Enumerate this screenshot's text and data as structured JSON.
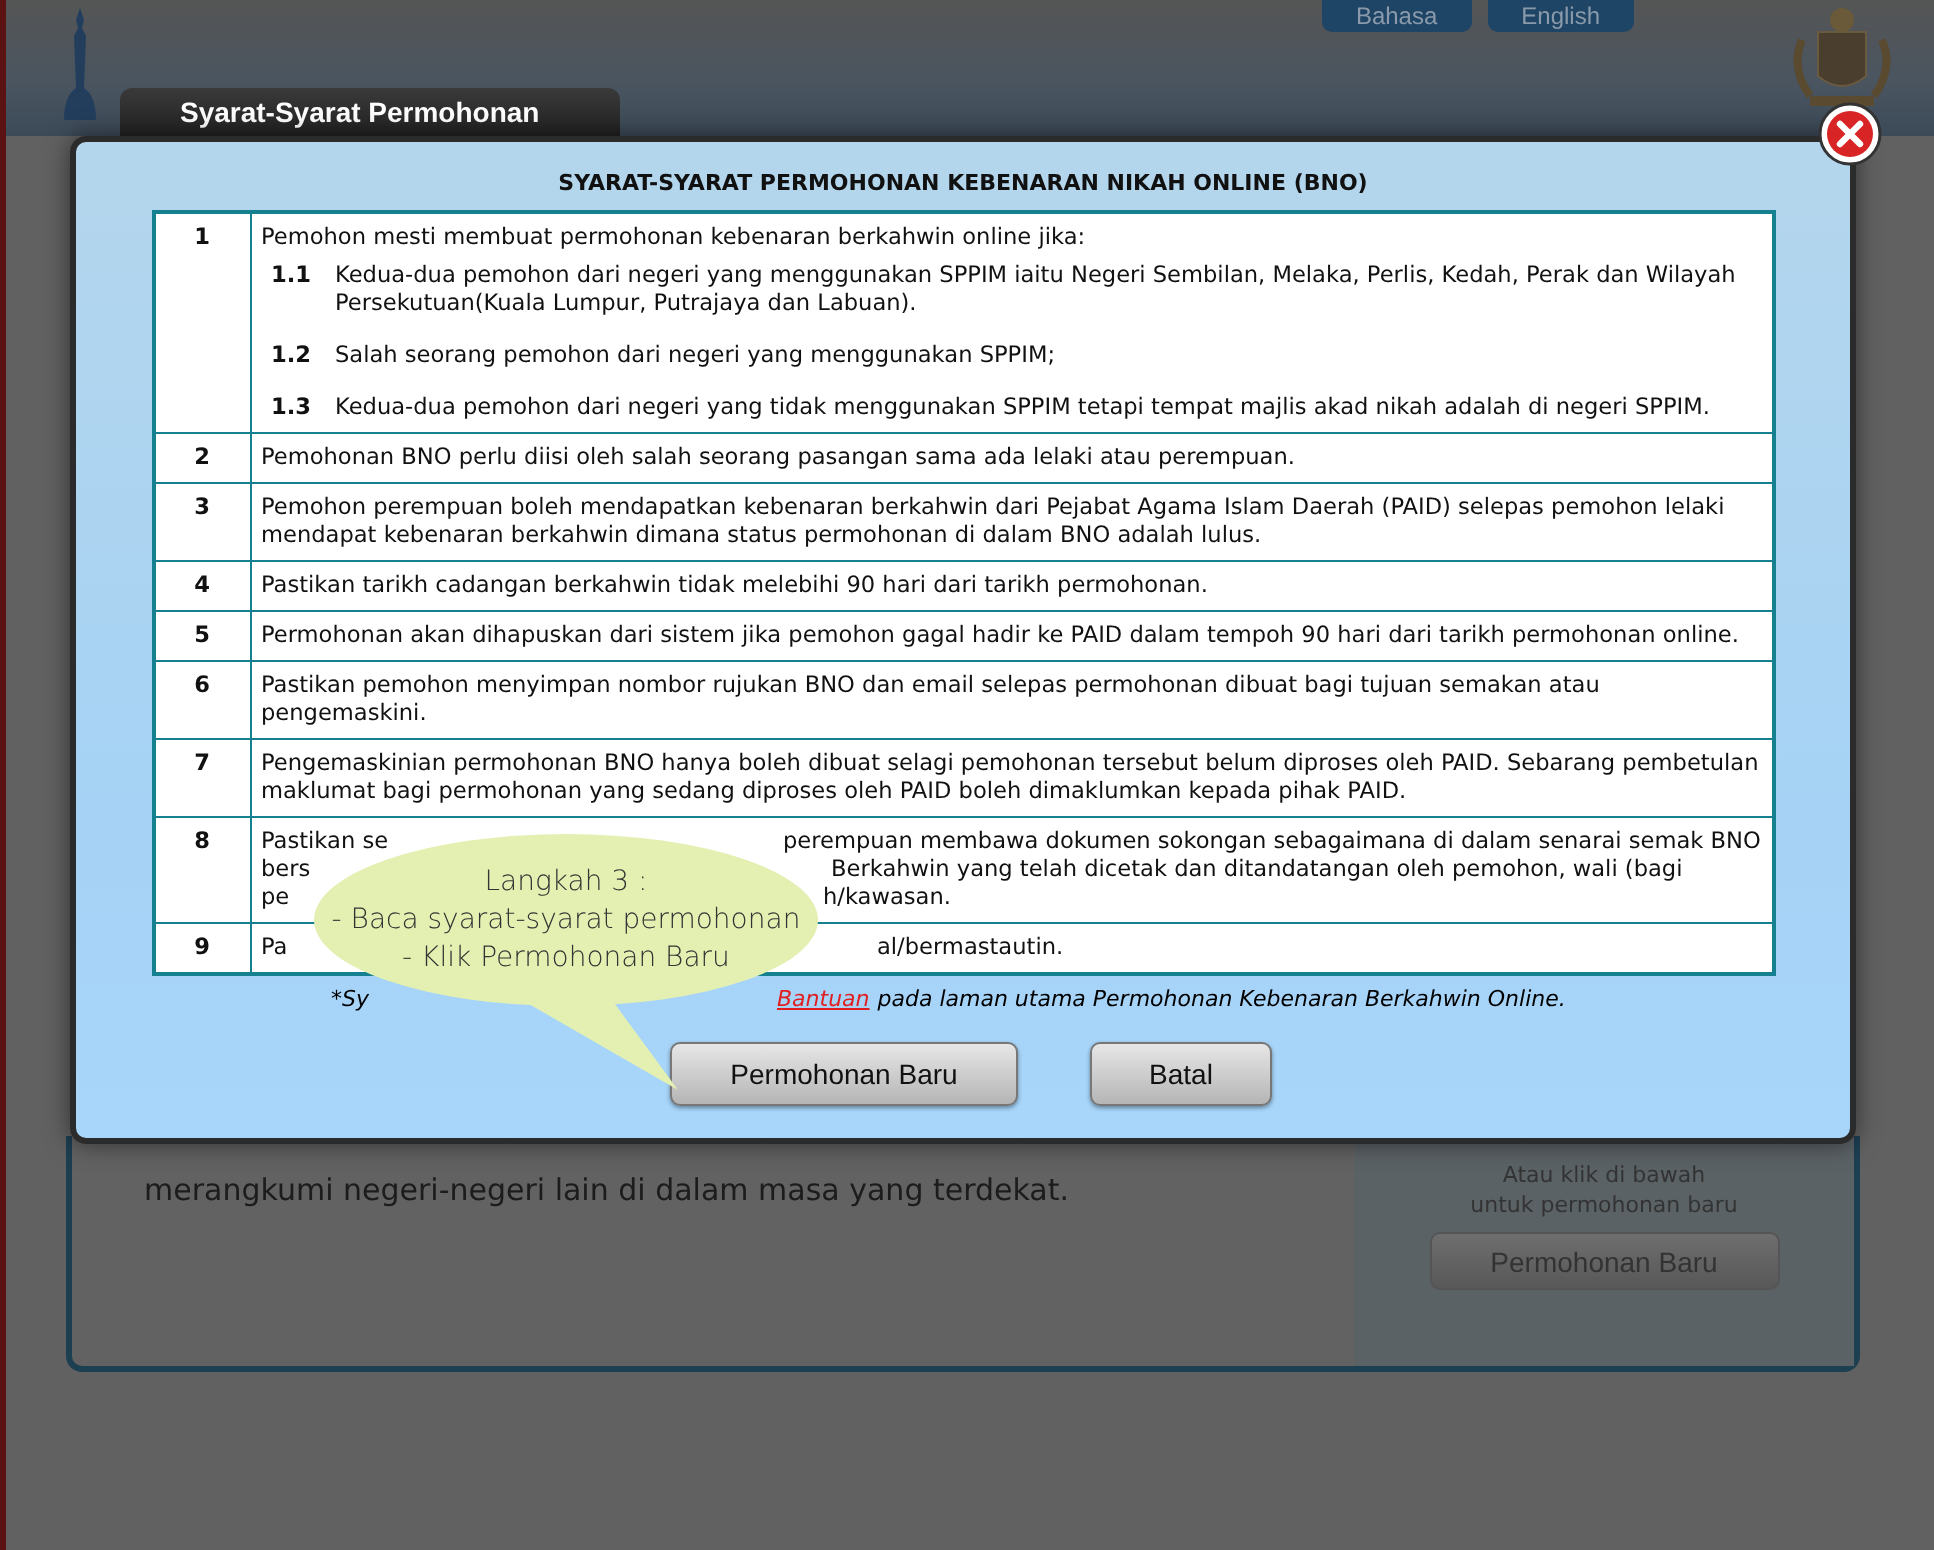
{
  "header": {
    "languages": [
      {
        "label": "Bahasa"
      },
      {
        "label": "English"
      }
    ]
  },
  "tab": {
    "label": "Syarat-Syarat Permohonan"
  },
  "modal": {
    "title": "SYARAT-SYARAT PERMOHONAN KEBENARAN NIKAH ONLINE (BNO)",
    "rows": [
      {
        "kind": "list",
        "number": "1",
        "text": "Pemohon mesti membuat permohonan kebenaran berkahwin online jika:",
        "subitems": [
          {
            "number": "1.1",
            "text": "Kedua-dua pemohon dari negeri yang menggunakan SPPIM iaitu Negeri Sembilan, Melaka, Perlis, Kedah, Perak dan Wilayah Persekutuan(Kuala Lumpur, Putrajaya dan Labuan)."
          },
          {
            "number": "1.2",
            "text": "Salah seorang pemohon dari negeri yang menggunakan SPPIM;"
          },
          {
            "number": "1.3",
            "text": "Kedua-dua pemohon dari negeri yang tidak menggunakan SPPIM tetapi tempat majlis akad nikah adalah di negeri SPPIM."
          }
        ]
      },
      {
        "kind": "text",
        "number": "2",
        "text": "Pemohonan BNO perlu diisi oleh salah seorang pasangan sama ada lelaki atau perempuan."
      },
      {
        "kind": "text",
        "number": "3",
        "text": "Pemohon perempuan boleh mendapatkan kebenaran berkahwin dari Pejabat Agama Islam Daerah (PAID) selepas pemohon lelaki mendapat kebenaran berkahwin dimana status permohonan di dalam BNO adalah lulus."
      },
      {
        "kind": "text",
        "number": "4",
        "text": "Pastikan tarikh cadangan berkahwin tidak melebihi 90 hari dari tarikh permohonan."
      },
      {
        "kind": "text",
        "number": "5",
        "text": "Permohonan akan dihapuskan dari sistem jika pemohon gagal hadir ke PAID dalam tempoh 90 hari dari tarikh permohonan online."
      },
      {
        "kind": "text",
        "number": "6",
        "text": "Pastikan pemohon menyimpan nombor rujukan BNO dan email selepas permohonan dibuat bagi tujuan semakan atau pengemaskini."
      },
      {
        "kind": "text",
        "number": "7",
        "text": "Pengemaskinian permohonan BNO hanya boleh dibuat selagi pemohonan tersebut belum diproses oleh PAID. Sebarang pembetulan maklumat bagi permohonan yang sedang diproses oleh PAID boleh dimaklumkan kepada pihak PAID."
      },
      {
        "kind": "fragments",
        "number": "8",
        "lines": [
          [
            "Pastikan se",
            "perempuan membawa dokumen sokongan sebagaimana di dalam senarai semak BNO"
          ],
          [
            "bers",
            "Berkahwin yang telah dicetak dan ditandatangan oleh pemohon, wali (bagi"
          ],
          [
            "pe",
            "h/kawasan."
          ]
        ]
      },
      {
        "kind": "fragments",
        "number": "9",
        "lines": [
          [
            "Pa",
            "al/bermastautin."
          ]
        ]
      }
    ],
    "footnote": {
      "start": "*Sy",
      "link": "Bantuan",
      "end": "pada laman utama Permohonan Kebenaran Berkahwin Online."
    },
    "buttons": [
      "Permohonan Baru",
      "Batal"
    ],
    "callout": {
      "lines": [
        "Langkah 3 :",
        "- Baca syarat-syarat permohonan",
        "- Klik Permohonan Baru"
      ]
    }
  },
  "background": {
    "paragraph": "merangkumi negeri-negeri lain di dalam masa yang terdekat.",
    "side_note": [
      "Atau klik di bawah",
      "untuk permohonan baru"
    ],
    "side_button": "Permohonan Baru"
  }
}
